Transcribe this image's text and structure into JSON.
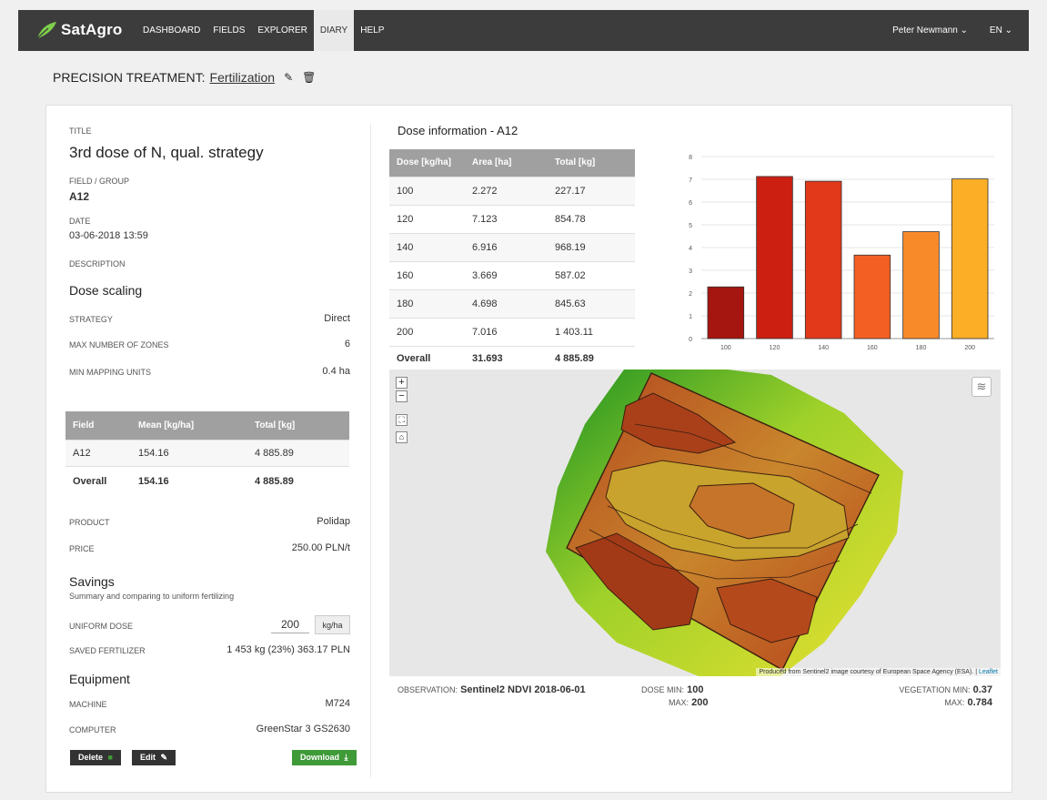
{
  "header": {
    "brand": "SatAgro",
    "nav": [
      {
        "label": "DASHBOARD"
      },
      {
        "label": "FIELDS"
      },
      {
        "label": "EXPLORER"
      },
      {
        "label": "DIARY",
        "active": true
      },
      {
        "label": "HELP"
      }
    ],
    "user": "Peter Newmann",
    "language": "EN"
  },
  "page": {
    "title_prefix": "PRECISION TREATMENT:",
    "title_link": "Fertilization",
    "edit_icon": "pencil-icon",
    "delete_icon": "trash-icon"
  },
  "left": {
    "title_label": "TITLE",
    "title": "3rd dose of N, qual. strategy",
    "field_label": "FIELD / GROUP",
    "field": "A12",
    "date_label": "DATE",
    "date": "03-06-2018 13:59",
    "description_label": "DESCRIPTION",
    "dose_scaling_heading": "Dose scaling",
    "strategy_label": "STRATEGY",
    "strategy": "Direct",
    "zones_label": "MAX NUMBER OF ZONES",
    "zones": "6",
    "mmu_label": "MIN MAPPING UNITS",
    "mmu": "0.4 ha",
    "field_table": {
      "headers": [
        "Field",
        "Mean [kg/ha]",
        "Total [kg]"
      ],
      "rows": [
        [
          "A12",
          "154.16",
          "4 885.89"
        ]
      ],
      "overall": [
        "Overall",
        "154.16",
        "4 885.89"
      ]
    },
    "product_label": "PRODUCT",
    "product": "Polidap",
    "price_label": "PRICE",
    "price": "250.00 PLN/t",
    "savings_heading": "Savings",
    "savings_sub": "Summary and comparing to uniform fertilizing",
    "uniform_label": "UNIFORM DOSE",
    "uniform_value": "200",
    "uniform_unit": "kg/ha",
    "saved_label": "SAVED FERTILIZER",
    "saved": "1 453 kg (23%)  363.17 PLN",
    "equipment_heading": "Equipment",
    "machine_label": "MACHINE",
    "machine": "M724",
    "computer_label": "COMPUTER",
    "computer": "GreenStar 3 GS2630",
    "buttons": {
      "delete": "Delete",
      "edit": "Edit",
      "download": "Download"
    }
  },
  "dose": {
    "heading": "Dose information - A12",
    "headers": [
      "Dose [kg/ha]",
      "Area [ha]",
      "Total [kg]"
    ],
    "rows": [
      [
        "100",
        "2.272",
        "227.17"
      ],
      [
        "120",
        "7.123",
        "854.78"
      ],
      [
        "140",
        "6.916",
        "968.19"
      ],
      [
        "160",
        "3.669",
        "587.02"
      ],
      [
        "180",
        "4.698",
        "845.63"
      ],
      [
        "200",
        "7.016",
        "1 403.11"
      ]
    ],
    "overall": [
      "Overall",
      "31.693",
      "4 885.89"
    ]
  },
  "chart_data": {
    "type": "bar",
    "categories": [
      "100",
      "120",
      "140",
      "160",
      "180",
      "200"
    ],
    "values": [
      2.272,
      7.123,
      6.916,
      3.669,
      4.698,
      7.016
    ],
    "colors": [
      "#a4160f",
      "#cc1f12",
      "#e2391a",
      "#f35f22",
      "#f98a2a",
      "#fbae26"
    ],
    "ylim": [
      0,
      8
    ],
    "yticks": [
      "0",
      "1",
      "2",
      "3",
      "4",
      "5",
      "6",
      "7",
      "8"
    ],
    "grid": true,
    "title": "",
    "xlabel": "",
    "ylabel": ""
  },
  "map": {
    "zoom_in": "+",
    "zoom_out": "−",
    "fullscreen_icon": "fullscreen-icon",
    "label_icon": "tag-icon",
    "layers_icon": "layers-icon",
    "attribution": "Produced from Sentinel2 image courtesy of European Space Agency (ESA). |",
    "attribution_link": "Leaflet"
  },
  "observation": {
    "label": "OBSERVATION:",
    "value": "Sentinel2 NDVI 2018-06-01",
    "dose_min_label": "DOSE MIN:",
    "dose_min": "100",
    "dose_max_label": "MAX:",
    "dose_max": "200",
    "veg_min_label": "VEGETATION MIN:",
    "veg_min": "0.37",
    "veg_max_label": "MAX:",
    "veg_max": "0.784"
  }
}
